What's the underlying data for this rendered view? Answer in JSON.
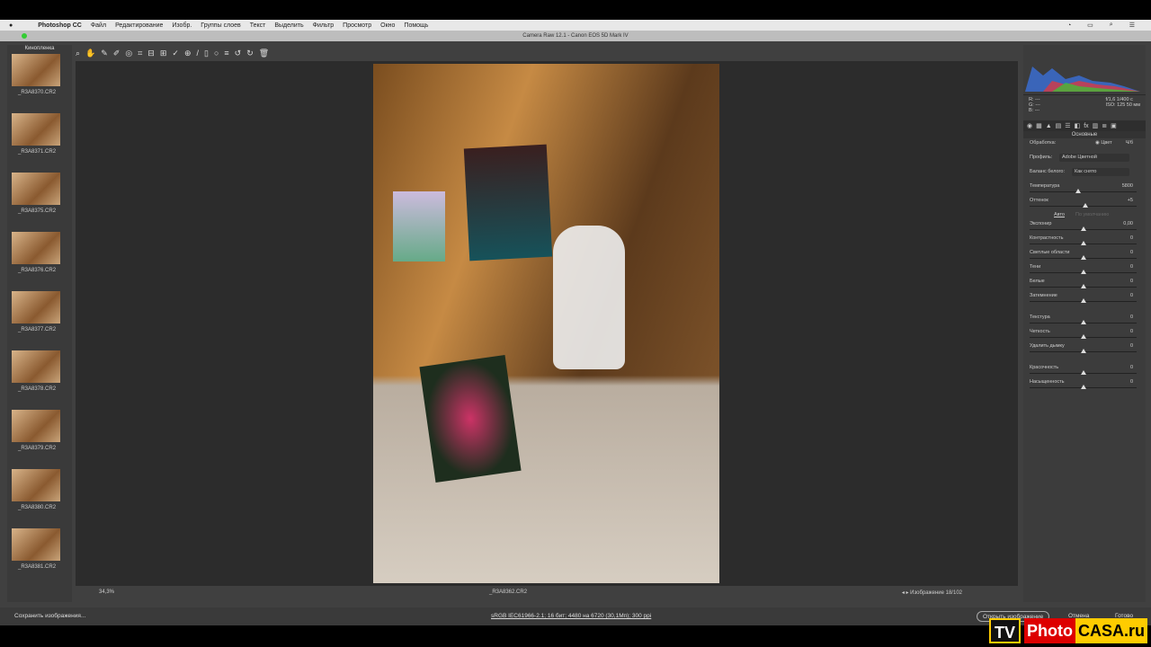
{
  "menubar": {
    "app": "Photoshop CC",
    "items": [
      "Файл",
      "Редактирование",
      "Изобр.",
      "Группы слоев",
      "Текст",
      "Выделить",
      "Фильтр",
      "Просмотр",
      "Окно",
      "Помощь"
    ]
  },
  "window_title": "Camera Raw 12.1  -  Canon EOS 5D Mark IV",
  "filmstrip": {
    "title": "Кинопленка",
    "items": [
      "_R3A8370.CR2",
      "_R3A8371.CR2",
      "_R3A8375.CR2",
      "_R3A8376.CR2",
      "_R3A8377.CR2",
      "_R3A8378.CR2",
      "_R3A8379.CR2",
      "_R3A8380.CR2",
      "_R3A8381.CR2"
    ]
  },
  "canvas": {
    "zoom": "34,3%",
    "filename": "_R3A8362.CR2",
    "nav": "Изображение 18/102"
  },
  "camera_info": {
    "r": "R:  ---",
    "g": "G:  ---",
    "b": "B:  ---",
    "aperture_shutter": "f/1,6   1/400 с",
    "iso_focal": "ISO: 125   50 мм"
  },
  "panel": {
    "section": "Основные",
    "processing_label": "Обработка:",
    "processing_value": "Цвет",
    "bw": "Ч/б",
    "profile_label": "Профиль:",
    "profile_value": "Adobe Цветной",
    "wb_label": "Баланс белого:",
    "wb_value": "Как снято",
    "auto": "Авто",
    "default": "По умолчанию",
    "sliders": [
      {
        "label": "Температура",
        "value": "5800",
        "pos": 0.45
      },
      {
        "label": "Оттенок",
        "value": "+5",
        "pos": 0.52
      },
      {
        "label": "Экспонир",
        "value": "0,00",
        "pos": 0.5
      },
      {
        "label": "Контрастность",
        "value": "0",
        "pos": 0.5
      },
      {
        "label": "Светлые области",
        "value": "0",
        "pos": 0.5
      },
      {
        "label": "Тени",
        "value": "0",
        "pos": 0.5
      },
      {
        "label": "Белые",
        "value": "0",
        "pos": 0.5
      },
      {
        "label": "Затемнение",
        "value": "0",
        "pos": 0.5
      },
      {
        "label": "Текстура",
        "value": "0",
        "pos": 0.5
      },
      {
        "label": "Четкость",
        "value": "0",
        "pos": 0.5
      },
      {
        "label": "Удалить дымку",
        "value": "0",
        "pos": 0.5
      },
      {
        "label": "Красочность",
        "value": "0",
        "pos": 0.5
      },
      {
        "label": "Насыщенность",
        "value": "0",
        "pos": 0.5
      }
    ]
  },
  "bottom": {
    "save": "Сохранить изображения...",
    "workflow": "sRGB IEC61966-2.1; 16 бит; 4480 на 6720 (30,1Мп); 300 ppi",
    "open": "Открыть изображение",
    "cancel": "Отмена",
    "done": "Готово"
  },
  "watermark": {
    "tv": "TV",
    "photo": "Photo",
    "casa": "CASA.ru"
  }
}
